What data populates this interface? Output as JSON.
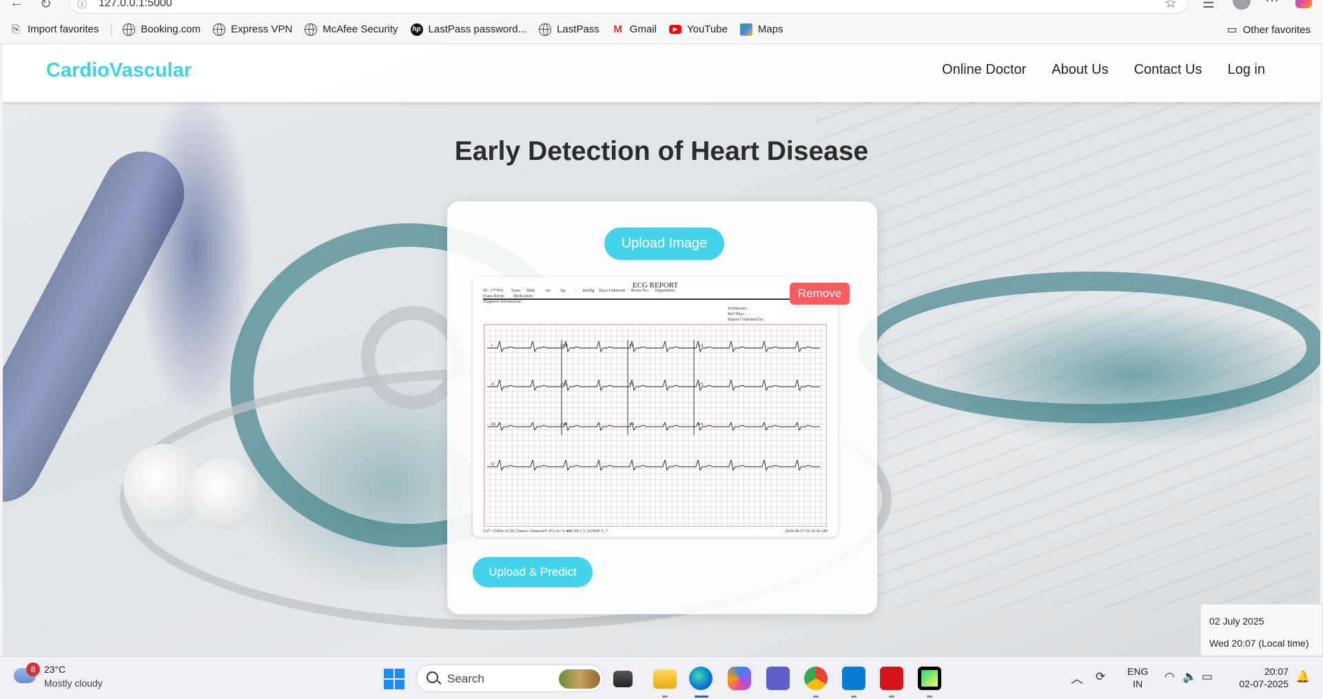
{
  "browser": {
    "url": "127.0.0.1:5000",
    "bookmarks": [
      {
        "label": "Import favorites",
        "icon": "import-icon"
      },
      {
        "label": "Booking.com",
        "icon": "globe-icon"
      },
      {
        "label": "Express VPN",
        "icon": "globe-icon"
      },
      {
        "label": "McAfee Security",
        "icon": "globe-icon"
      },
      {
        "label": "LastPass password...",
        "icon": "hp-icon"
      },
      {
        "label": "LastPass",
        "icon": "globe-icon"
      },
      {
        "label": "Gmail",
        "icon": "gmail-icon"
      },
      {
        "label": "YouTube",
        "icon": "youtube-icon"
      },
      {
        "label": "Maps",
        "icon": "maps-icon"
      }
    ],
    "other_favorites": "Other favorites"
  },
  "navbar": {
    "brand": "CardioVascular",
    "links": [
      "Online Doctor",
      "About Us",
      "Contact Us",
      "Log in"
    ],
    "brand_color": "#3fd1e6"
  },
  "main": {
    "headline": "Early Detection of Heart Disease",
    "upload_label": "Upload Image",
    "remove_label": "Remove",
    "predict_label": "Upload & Predict",
    "accent_color": "#44d3e8",
    "remove_color": "#ff5a5f"
  },
  "ecg_preview": {
    "title": "ECG  REPORT",
    "header_line1": "ID : 177954        Years      Male          cm          kg          /      mmHg     Race:Unknown      Room No.:     Department:",
    "header_line2": "Exam.Room:        Medication:",
    "header_line3": "Diagnosis Information:",
    "tech_lines": [
      "Technician :",
      "Ref+Phys :",
      "Report Confirmed by:"
    ],
    "leads": [
      [
        "I",
        "aVR",
        "V1",
        "V4"
      ],
      [
        "II",
        "aVL",
        "V2",
        "V5"
      ],
      [
        "III",
        "aVF",
        "V3",
        "V6"
      ],
      [
        "II",
        "",
        "",
        ""
      ]
    ],
    "footer_left": "0.67~150Hz  AC50  25mm/s  10mm/mV  4*2.5s+1r  ♥80    SE:1  V_8   HMP V_7",
    "footer_right": "2020-08-17    01:36:26   AM"
  },
  "date_tooltip": {
    "date": "02 July 2025",
    "time": "Wed 20:07 (Local time)"
  },
  "taskbar": {
    "weather_temp": "23°C",
    "weather_desc": "Mostly cloudy",
    "weather_badge": "8",
    "search_placeholder": "Search",
    "lang_top": "ENG",
    "lang_bottom": "IN",
    "clock_time": "20:07",
    "clock_date": "02-07-2025",
    "pinned": [
      "file-explorer-icon",
      "edge-icon",
      "copilot-icon",
      "teams-icon",
      "chrome-icon",
      "vscode-icon",
      "acrobat-icon",
      "pycharm-icon"
    ]
  }
}
